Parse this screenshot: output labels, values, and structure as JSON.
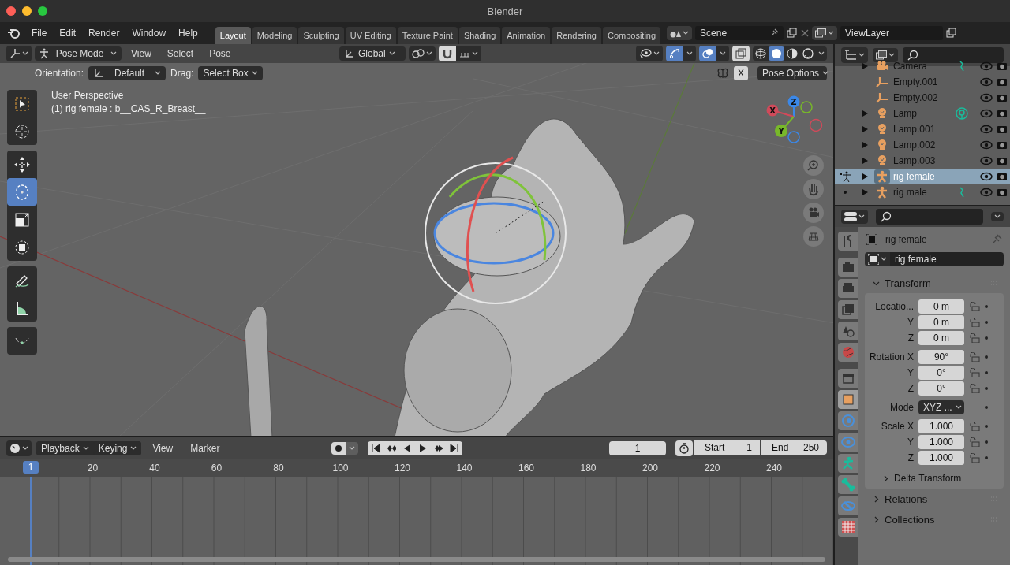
{
  "window": {
    "title": "Blender"
  },
  "menu": [
    "File",
    "Edit",
    "Render",
    "Window",
    "Help"
  ],
  "workspaces": [
    {
      "label": "Layout",
      "selected": true
    },
    {
      "label": "Modeling",
      "selected": false
    },
    {
      "label": "Sculpting",
      "selected": false
    },
    {
      "label": "UV Editing",
      "selected": false
    },
    {
      "label": "Texture Paint",
      "selected": false
    },
    {
      "label": "Shading",
      "selected": false
    },
    {
      "label": "Animation",
      "selected": false
    },
    {
      "label": "Rendering",
      "selected": false
    },
    {
      "label": "Compositing",
      "selected": false
    }
  ],
  "scene": {
    "value": "Scene"
  },
  "view_layer": {
    "value": "ViewLayer"
  },
  "viewport": {
    "mode": "Pose Mode",
    "menus": [
      "View",
      "Select",
      "Pose"
    ],
    "orientation": "Global",
    "shading": [
      {
        "kind": "wireframe",
        "selected": false
      },
      {
        "kind": "solid",
        "selected": true
      },
      {
        "kind": "material",
        "selected": false
      },
      {
        "kind": "rendered",
        "selected": false
      }
    ],
    "tool_settings": {
      "orientation_label": "Orientation:",
      "orientation": "Default",
      "drag_label": "Drag:",
      "drag": "Select Box",
      "mirror": "X",
      "pose_options": "Pose Options"
    },
    "tools": [
      {
        "kind": "select",
        "selected": false
      },
      {
        "kind": "cursor",
        "selected": false
      },
      {
        "kind": "move",
        "selected": false
      },
      {
        "kind": "rotate",
        "selected": true
      },
      {
        "kind": "scale",
        "selected": false
      },
      {
        "kind": "transform",
        "selected": false
      },
      {
        "kind": "annotate",
        "selected": false
      },
      {
        "kind": "measure",
        "selected": false
      },
      {
        "kind": "relax",
        "selected": false
      }
    ],
    "overlay_text": [
      "User Perspective",
      "(1) rig female : b__CAS_R_Breast__"
    ],
    "axes": {
      "x": "X",
      "y": "Y",
      "z": "Z"
    }
  },
  "timeline": {
    "menus": [
      "Playback",
      "Keying"
    ],
    "plain_menus": [
      "View",
      "Marker"
    ],
    "current_frame": "1",
    "start_label": "Start",
    "start": "1",
    "end_label": "End",
    "end": "250",
    "playhead": "1",
    "ruler": [
      "20",
      "40",
      "60",
      "80",
      "100",
      "120",
      "140",
      "160",
      "180",
      "200",
      "220",
      "240"
    ]
  },
  "outliner": {
    "items": [
      {
        "name": "Camera",
        "kind": "camera",
        "expandable": true,
        "selected": false,
        "pose_mode": false,
        "data_icon": true
      },
      {
        "name": "Empty.001",
        "kind": "empty",
        "expandable": false,
        "selected": false,
        "pose_mode": false,
        "data_icon": false
      },
      {
        "name": "Empty.002",
        "kind": "empty",
        "expandable": false,
        "selected": false,
        "pose_mode": false,
        "data_icon": false
      },
      {
        "name": "Lamp",
        "kind": "lamp",
        "expandable": true,
        "selected": false,
        "pose_mode": false,
        "data_icon": true
      },
      {
        "name": "Lamp.001",
        "kind": "lamp",
        "expandable": true,
        "selected": false,
        "pose_mode": false,
        "data_icon": false
      },
      {
        "name": "Lamp.002",
        "kind": "lamp",
        "expandable": true,
        "selected": false,
        "pose_mode": false,
        "data_icon": false
      },
      {
        "name": "Lamp.003",
        "kind": "lamp",
        "expandable": true,
        "selected": false,
        "pose_mode": false,
        "data_icon": false
      },
      {
        "name": "rig female",
        "kind": "armature",
        "expandable": true,
        "selected": true,
        "pose_mode": true,
        "data_icon": false
      },
      {
        "name": "rig male",
        "kind": "armature",
        "expandable": true,
        "selected": false,
        "pose_mode": false,
        "data_icon": true
      }
    ]
  },
  "properties": {
    "tabs": [
      {
        "kind": "tool",
        "selected": false
      },
      {
        "kind": "render",
        "selected": false
      },
      {
        "kind": "output",
        "selected": false
      },
      {
        "kind": "view_layer",
        "selected": false
      },
      {
        "kind": "scene",
        "selected": false
      },
      {
        "kind": "world",
        "selected": false
      },
      {
        "kind": "collection",
        "selected": false
      },
      {
        "kind": "object",
        "selected": true
      },
      {
        "kind": "modifiers",
        "selected": false
      },
      {
        "kind": "constraints",
        "selected": false
      },
      {
        "kind": "data",
        "selected": false
      },
      {
        "kind": "bone",
        "selected": false
      },
      {
        "kind": "bone_constraints",
        "selected": false
      },
      {
        "kind": "texture",
        "selected": false
      }
    ],
    "object_name": "rig female",
    "name_field": "rig female",
    "transform": {
      "title": "Transform",
      "expanded": true,
      "groups": [
        {
          "kind": "fields",
          "rows": [
            {
              "label": "Locatio...",
              "value": "0 m"
            },
            {
              "label": "Y",
              "value": "0 m"
            },
            {
              "label": "Z",
              "value": "0 m"
            }
          ]
        },
        {
          "kind": "fields",
          "rows": [
            {
              "label": "Rotation X",
              "value": "90°"
            },
            {
              "label": "Y",
              "value": "0°"
            },
            {
              "label": "Z",
              "value": "0°"
            }
          ]
        },
        {
          "kind": "dropdown",
          "rows": [
            {
              "label": "Mode",
              "value": "XYZ ..."
            }
          ]
        },
        {
          "kind": "fields",
          "rows": [
            {
              "label": "Scale X",
              "value": "1.000"
            },
            {
              "label": "Y",
              "value": "1.000"
            },
            {
              "label": "Z",
              "value": "1.000"
            }
          ]
        }
      ],
      "subpanel": {
        "title": "Delta Transform",
        "expanded": false
      }
    },
    "panels": [
      {
        "title": "Relations",
        "expanded": false
      },
      {
        "title": "Collections",
        "expanded": false
      }
    ]
  }
}
